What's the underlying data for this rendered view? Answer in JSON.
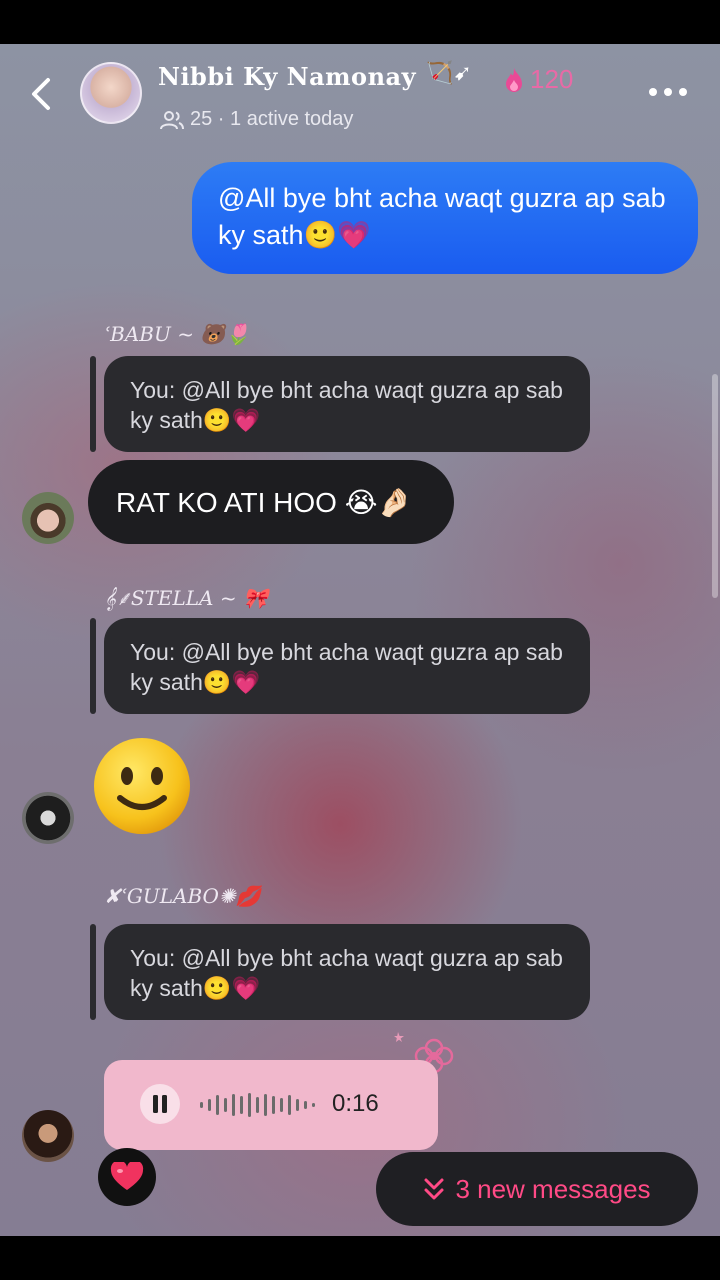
{
  "header": {
    "title": "Nibbi Ky Namonay",
    "title_decoration": "🏹➹",
    "streak_count": "120",
    "members_text": "25 · 1 active today"
  },
  "messages": {
    "own_message": "@All bye bht acha waqt guzra ap sab ky sath🙂💗",
    "sender1_name": "ʿBABU ~ 🐻🌷",
    "quote1": "You: @All bye bht acha waqt guzra ap sab ky sath🙂💗",
    "reply1": "RAT KO ATI HOO 😭🤌🏻",
    "sender2_name": "𝄞⸙STELLA ~ 🎀",
    "quote2": "You: @All bye bht acha waqt guzra ap sab ky sath🙂💗",
    "sender3_name": "✘ʿGULABO✺💋",
    "quote3": "You: @All bye bht acha waqt guzra ap sab ky sath🙂💗",
    "voice_time": "0:16"
  },
  "new_messages_label": "3 new messages",
  "icons": {
    "back": "chevron-left-icon",
    "more": "more-dots-icon",
    "flame": "flame-icon",
    "members": "people-icon",
    "pause": "pause-icon",
    "heart": "heart-icon",
    "double_chevron": "double-chevron-down-icon"
  },
  "colors": {
    "own_bubble": "#2d7cf5",
    "accent_pink": "#ff4a86",
    "voice_bubble": "#f1b8cc"
  }
}
